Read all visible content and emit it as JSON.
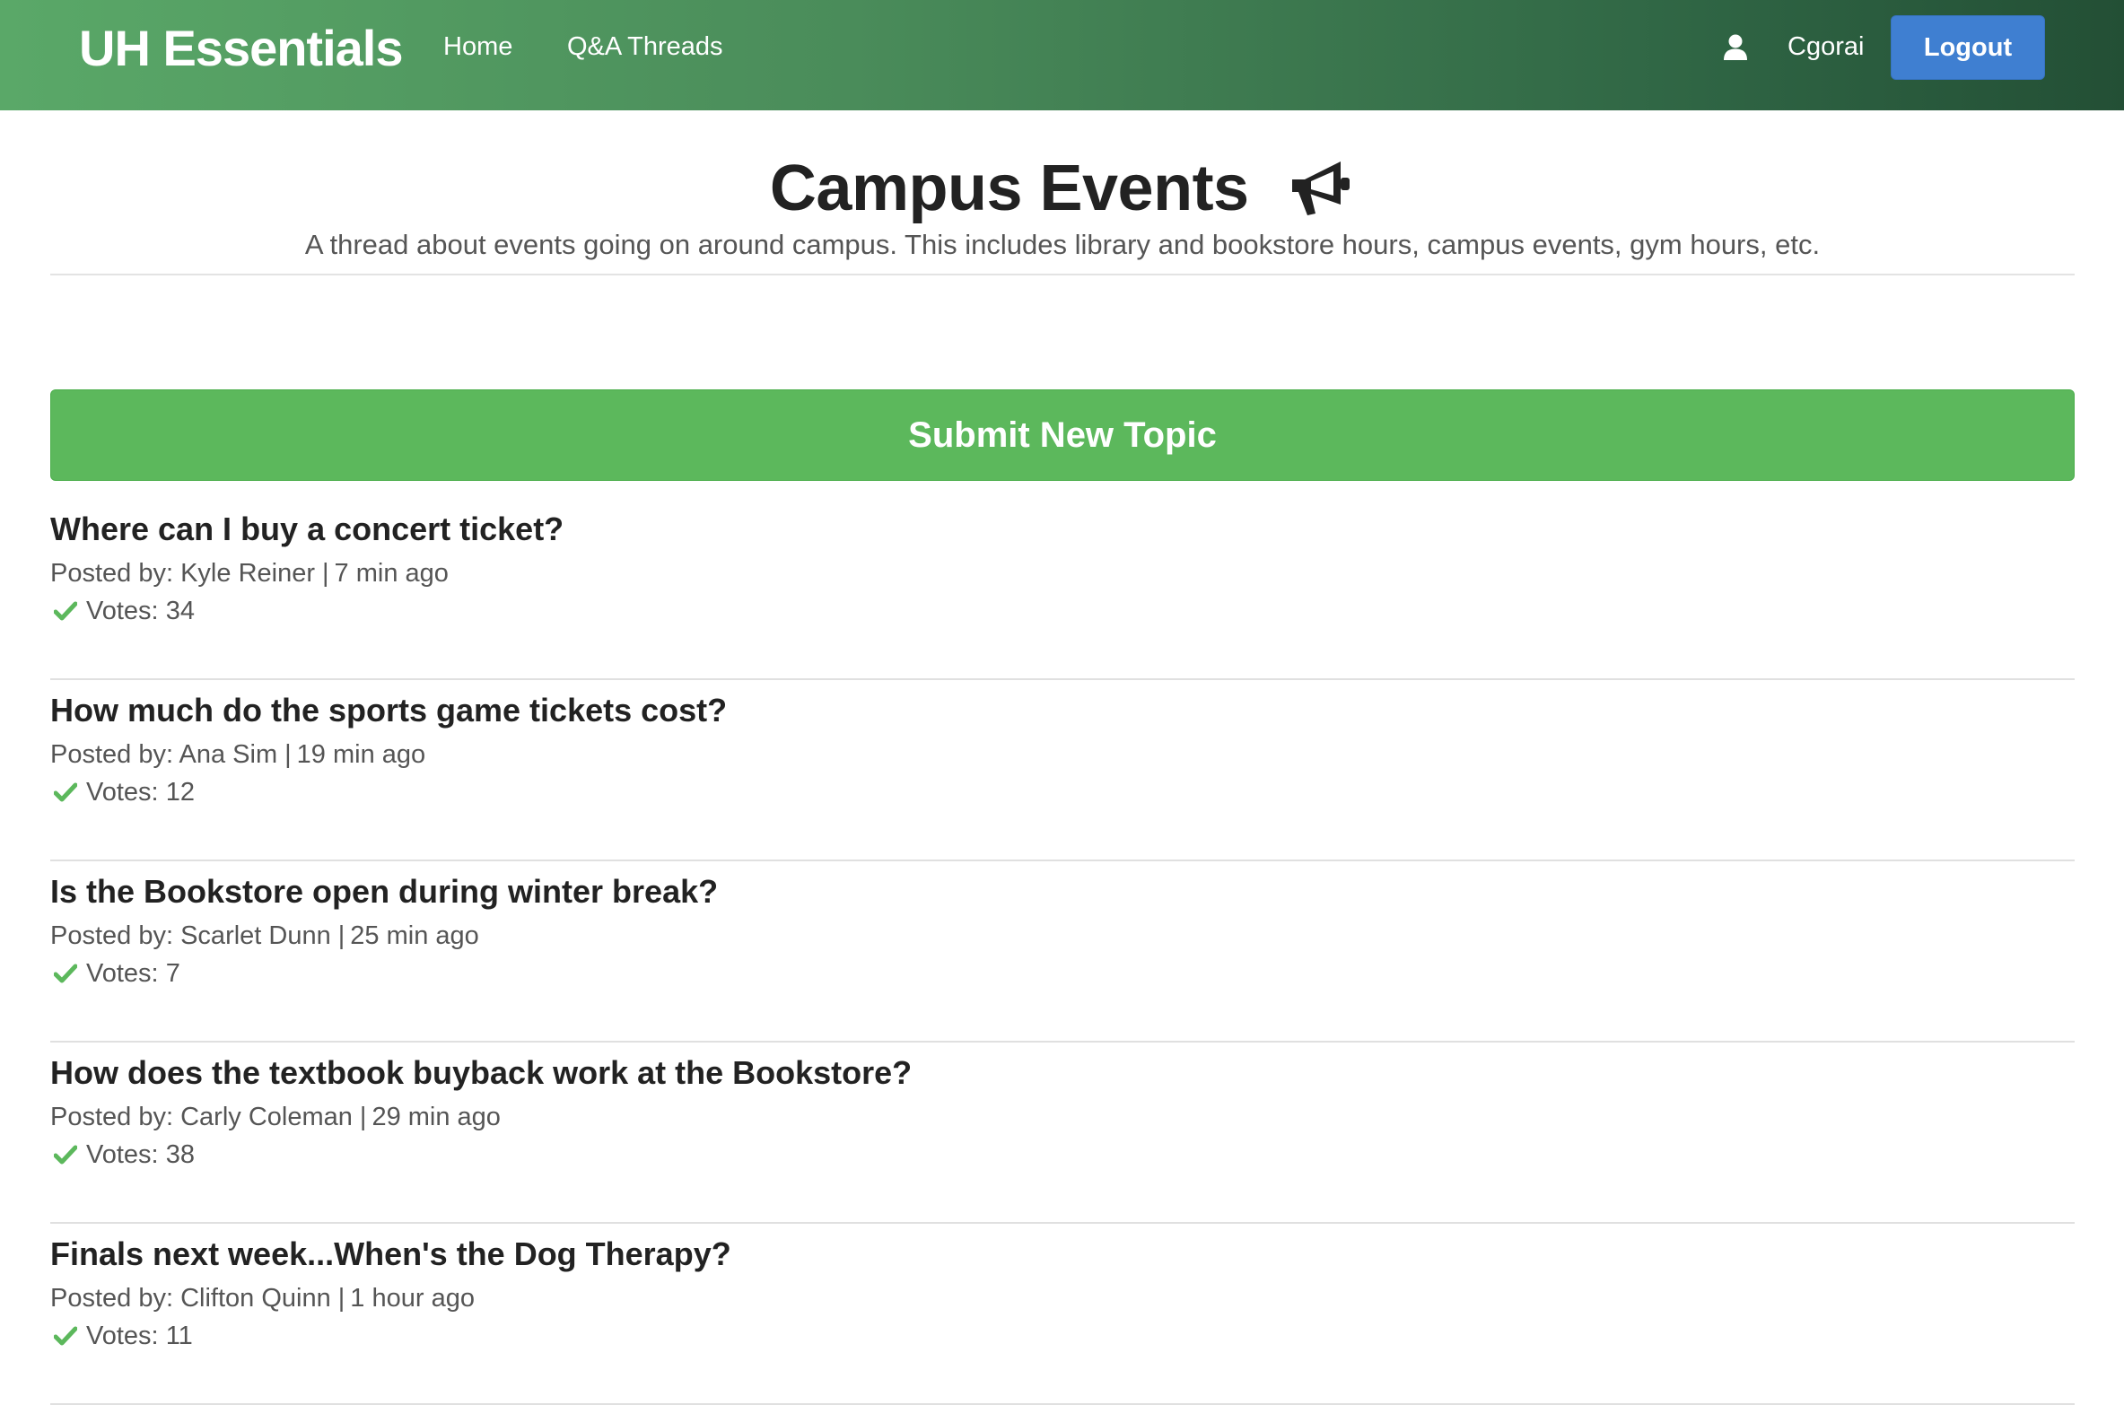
{
  "navbar": {
    "brand": "UH Essentials",
    "links": [
      "Home",
      "Q&A Threads"
    ],
    "user_icon": "user-icon",
    "username": "Cgorai",
    "logout_label": "Logout"
  },
  "header": {
    "title": "Campus Events",
    "title_icon": "megaphone-icon",
    "subtitle": "A thread about events going on around campus. This includes library and bookstore hours, campus events, gym hours, etc."
  },
  "submit_label": "Submit New Topic",
  "posted_by_prefix": "Posted by:",
  "votes_prefix": "Votes:",
  "vote_icon": "check-icon",
  "topics": [
    {
      "title": "Where can I buy a concert ticket?",
      "author": "Kyle Reiner",
      "time": "7 min ago",
      "votes": "34"
    },
    {
      "title": "How much do the sports game tickets cost?",
      "author": "Ana Sim",
      "time": "19 min ago",
      "votes": "12"
    },
    {
      "title": "Is the Bookstore open during winter break?",
      "author": "Scarlet Dunn",
      "time": "25 min ago",
      "votes": "7"
    },
    {
      "title": "How does the textbook buyback work at the Bookstore?",
      "author": "Carly Coleman",
      "time": "29 min ago",
      "votes": "38"
    },
    {
      "title": "Finals next week...When's the Dog Therapy?",
      "author": "Clifton Quinn",
      "time": "1 hour ago",
      "votes": "11"
    }
  ],
  "colors": {
    "navbar_start": "#5aa868",
    "navbar_end": "#234f35",
    "logout_button": "#3f7fd1",
    "submit_button": "#5cb85c",
    "vote_check": "#5cb85c"
  }
}
